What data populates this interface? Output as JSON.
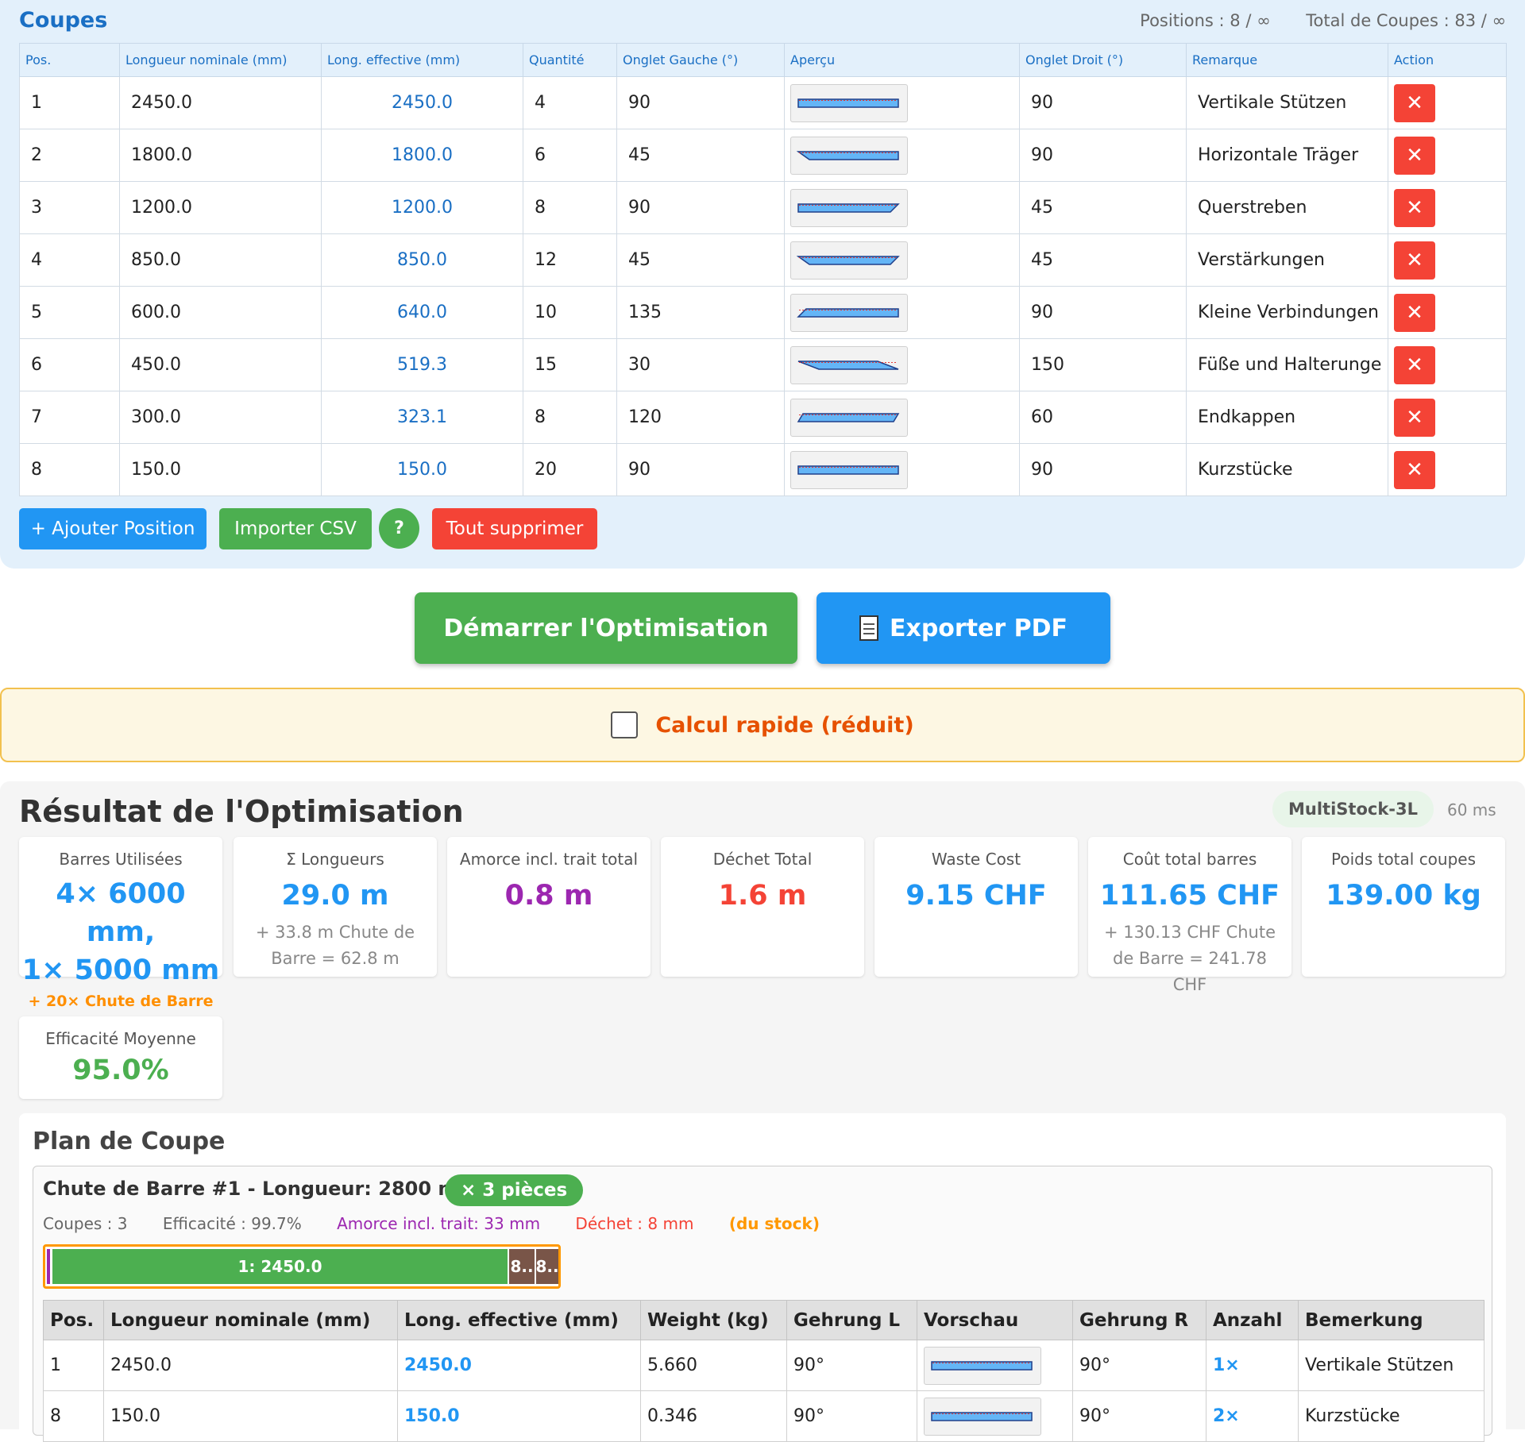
{
  "coupes": {
    "title": "Coupes",
    "positions_stat": "Positions : 8 / ∞",
    "total_stat": "Total de Coupes : 83 / ∞",
    "headers": [
      "Pos.",
      "Longueur nominale (mm)",
      "Long. effective (mm)",
      "Quantité",
      "Onglet Gauche (°)",
      "Aperçu",
      "Onglet Droit (°)",
      "Remarque",
      "Action"
    ],
    "rows": [
      {
        "pos": "1",
        "nominal": "2450.0",
        "effective": "2450.0",
        "qty": "4",
        "left": "90",
        "right": "90",
        "remark": "Vertikale Stützen"
      },
      {
        "pos": "2",
        "nominal": "1800.0",
        "effective": "1800.0",
        "qty": "6",
        "left": "45",
        "right": "90",
        "remark": "Horizontale Träger"
      },
      {
        "pos": "3",
        "nominal": "1200.0",
        "effective": "1200.0",
        "qty": "8",
        "left": "90",
        "right": "45",
        "remark": "Querstreben"
      },
      {
        "pos": "4",
        "nominal": "850.0",
        "effective": "850.0",
        "qty": "12",
        "left": "45",
        "right": "45",
        "remark": "Verstärkungen"
      },
      {
        "pos": "5",
        "nominal": "600.0",
        "effective": "640.0",
        "qty": "10",
        "left": "135",
        "right": "90",
        "remark": "Kleine Verbindungen"
      },
      {
        "pos": "6",
        "nominal": "450.0",
        "effective": "519.3",
        "qty": "15",
        "left": "30",
        "right": "150",
        "remark": "Füße und Halterunge"
      },
      {
        "pos": "7",
        "nominal": "300.0",
        "effective": "323.1",
        "qty": "8",
        "left": "120",
        "right": "60",
        "remark": "Endkappen"
      },
      {
        "pos": "8",
        "nominal": "150.0",
        "effective": "150.0",
        "qty": "20",
        "left": "90",
        "right": "90",
        "remark": "Kurzstücke"
      }
    ],
    "delete_icon": "✕",
    "buttons": {
      "add": "+ Ajouter Position",
      "csv": "Importer CSV",
      "help": "?",
      "clear": "Tout supprimer"
    }
  },
  "actions": {
    "start": "Démarrer l'Optimisation",
    "pdf": "Exporter PDF",
    "pdf_icon": "document-icon"
  },
  "quick_calc": {
    "label": "Calcul rapide (réduit)",
    "checked": false
  },
  "results": {
    "title": "Résultat de l'Optimisation",
    "algorithm": "MultiStock-3L",
    "time": "60 ms",
    "cards": {
      "bars": {
        "title": "Barres Utilisées",
        "line1": "4× 6000 mm,",
        "line2": "1× 5000 mm",
        "extra": "+ 20× Chute de Barre"
      },
      "lengths": {
        "title": "Σ Longueurs",
        "value": "29.0 m",
        "sub": "+ 33.8 m Chute de Barre = 62.8 m"
      },
      "kerf": {
        "title": "Amorce incl. trait total",
        "value": "0.8 m"
      },
      "waste": {
        "title": "Déchet Total",
        "value": "1.6 m"
      },
      "waste_cost": {
        "title": "Waste Cost",
        "value": "9.15 CHF"
      },
      "bar_cost": {
        "title": "Coût total barres",
        "value": "111.65 CHF",
        "sub": "+ 130.13 CHF Chute de Barre = 241.78 CHF"
      },
      "weight": {
        "title": "Poids total coupes",
        "value": "139.00 kg"
      },
      "efficiency": {
        "title": "Efficacité Moyenne",
        "value": "95.0%"
      }
    },
    "colors": {
      "blue": "#2196f3",
      "purple": "#9c27b0",
      "red": "#f44336",
      "green": "#4caf50",
      "orange": "#ff8f00"
    }
  },
  "plan": {
    "title": "Plan de Coupe",
    "stock": {
      "title": "Chute de Barre #1 - Longueur: 2800 mm",
      "pieces": "× 3 pièces",
      "cuts": "Coupes : 3",
      "efficiency": "Efficacité : 99.7%",
      "kerf": "Amorce incl. trait: 33 mm",
      "waste": "Déchet : 8 mm",
      "source": "(du stock)",
      "bar_segments": [
        "1: 2450.0",
        "8..",
        "8.."
      ]
    },
    "headers": [
      "Pos.",
      "Longueur nominale (mm)",
      "Long. effective (mm)",
      "Weight (kg)",
      "Gehrung L",
      "Vorschau",
      "Gehrung R",
      "Anzahl",
      "Bemerkung"
    ],
    "rows": [
      {
        "pos": "1",
        "nominal": "2450.0",
        "effective": "2450.0",
        "weight": "5.660",
        "left": "90°",
        "right": "90°",
        "count": "1×",
        "remark": "Vertikale Stützen"
      },
      {
        "pos": "8",
        "nominal": "150.0",
        "effective": "150.0",
        "weight": "0.346",
        "left": "90°",
        "right": "90°",
        "count": "2×",
        "remark": "Kurzstücke"
      }
    ]
  }
}
